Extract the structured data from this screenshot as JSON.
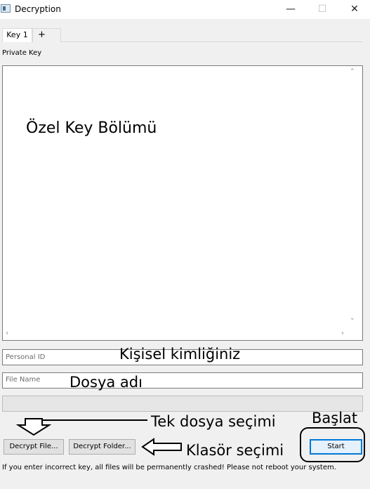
{
  "window": {
    "title": "Decryption",
    "minimize_glyph": "—",
    "maximize_glyph": "☐",
    "close_glyph": "✕"
  },
  "tabs": [
    {
      "label": "Key 1",
      "active": true
    },
    {
      "label": "+",
      "active": false
    }
  ],
  "private_key": {
    "label": "Private Key",
    "value": "",
    "annotation": "Özel Key Bölümü"
  },
  "personal_id": {
    "placeholder": "Personal ID",
    "annotation": "Kişisel kimliğiniz"
  },
  "file_name": {
    "placeholder": "File Name",
    "annotation": "Dosya adı"
  },
  "progress": {
    "value": 0
  },
  "buttons": {
    "decrypt_file": "Decrypt File...",
    "decrypt_folder": "Decrypt Folder...",
    "start": "Start"
  },
  "annotations": {
    "single_file": "Tek dosya seçimi",
    "folder": "Klasör seçimi",
    "start": "Başlat"
  },
  "warning": "If you enter incorrect key, all files will be permanently crashed! Please not reboot your system.",
  "colors": {
    "progress_fill": "#06b025",
    "start_focus": "#0078d7"
  }
}
